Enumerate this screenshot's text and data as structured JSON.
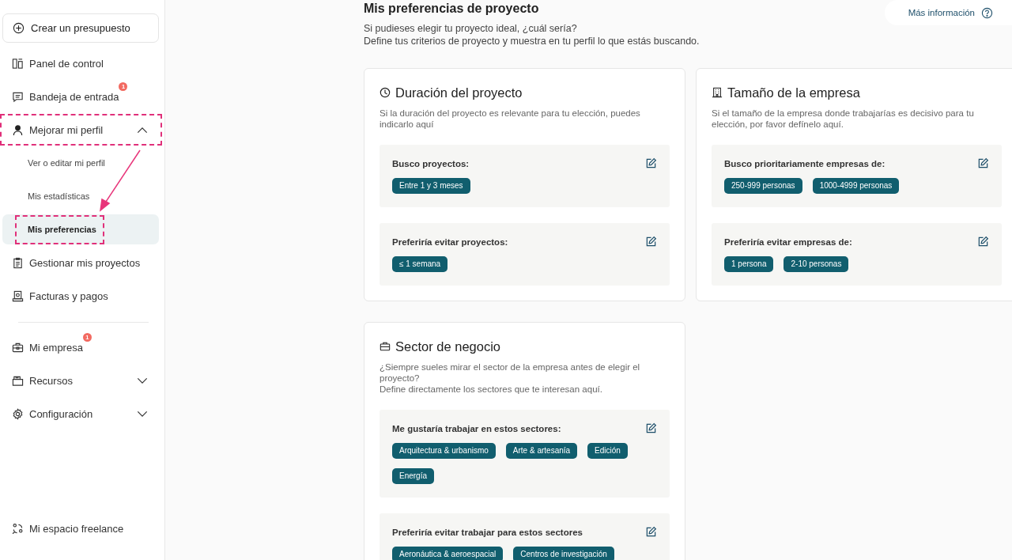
{
  "sidebar": {
    "create_button": {
      "label": "Crear un presupuesto"
    },
    "sections": [
      [
        {
          "label": "Panel de control",
          "highlighted": false
        },
        {
          "label": "Bandeja de entrada",
          "badge": "1",
          "highlighted": false
        },
        {
          "label": "Mejorar mi perfil",
          "expanded": true,
          "highlighted": true,
          "children": [
            {
              "label": "Ver o editar mi perfil",
              "selected": false,
              "highlighted": false
            },
            {
              "label": "Mis estadísticas",
              "selected": false,
              "highlighted": false
            },
            {
              "label": "Mis preferencias",
              "selected": true,
              "highlighted": true
            }
          ]
        },
        {
          "label": "Gestionar mis proyectos",
          "highlighted": false
        },
        {
          "label": "Facturas y pagos",
          "highlighted": false
        }
      ],
      [
        {
          "label": "Mi empresa",
          "badge": "1",
          "highlighted": false
        },
        {
          "label": "Recursos",
          "expanded": false,
          "highlighted": false
        },
        {
          "label": "Configuración",
          "expanded": false,
          "highlighted": false
        }
      ]
    ],
    "footer_item": {
      "label": "Mi espacio freelance"
    }
  },
  "help_button": {
    "label": "Más información"
  },
  "page": {
    "title": "Mis preferencias de proyecto",
    "intro": [
      "Si pudieses elegir tu proyecto ideal, ¿cuál sería?",
      "Define tus criterios de proyecto y muestra en tu perfil lo que estás buscando."
    ]
  },
  "cards": [
    {
      "title": "Duración del proyecto",
      "description": [
        "Si la duración del proyecto es relevante para tu elección, puedes indicarlo aquí"
      ],
      "groups": [
        {
          "label": "Busco proyectos:",
          "tags": [
            "Entre 1 y 3 meses"
          ]
        },
        {
          "label": "Preferiría evitar proyectos:",
          "tags": [
            "≤ 1 semana"
          ]
        }
      ]
    },
    {
      "title": "Tamaño de la empresa",
      "description": [
        "Si el tamaño de la empresa donde trabajarías es decisivo para tu elección, por favor defínelo aquí."
      ],
      "groups": [
        {
          "label": "Busco prioritariamente empresas de:",
          "tags": [
            "250-999 personas",
            "1000-4999 personas"
          ]
        },
        {
          "label": "Preferiría evitar empresas de:",
          "tags": [
            "1 persona",
            "2-10 personas"
          ]
        }
      ]
    },
    {
      "title": "Sector de negocio",
      "description": [
        "¿Siempre sueles mirar el sector de la empresa antes de elegir el proyecto?",
        "Define directamente los sectores que te interesan aquí."
      ],
      "groups": [
        {
          "label": "Me gustaría trabajar en estos sectores:",
          "tags": [
            "Arquitectura & urbanismo",
            "Arte & artesanía",
            "Edición",
            "Energía"
          ]
        },
        {
          "label": "Preferiría evitar trabajar para estos sectores",
          "tags": [
            "Aeronáutica & aeroespacial",
            "Centros de investigación"
          ]
        }
      ]
    }
  ]
}
